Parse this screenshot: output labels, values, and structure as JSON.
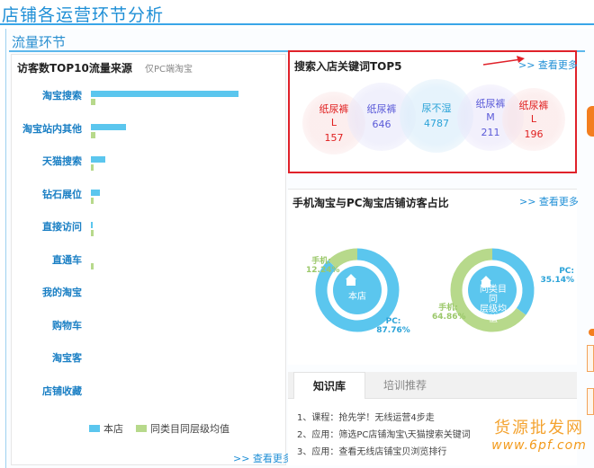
{
  "page": {
    "title": "店铺各运营环节分析",
    "section_title": "流量环节"
  },
  "left_panel": {
    "title": "访客数TOP10流量来源",
    "subtitle": "仅PC端淘宝",
    "categories": [
      "淘宝搜索",
      "淘宝站内其他",
      "天猫搜索",
      "钻石展位",
      "直接访问",
      "直通车",
      "我的淘宝",
      "购物车",
      "淘宝客",
      "店铺收藏"
    ],
    "store_bar_pct": [
      100,
      24,
      10,
      6,
      1,
      0,
      0,
      0,
      0,
      0
    ],
    "peer_bar_pct": [
      3,
      3,
      2,
      1,
      1,
      1,
      0,
      0,
      0,
      0
    ],
    "legend": {
      "store": "本店",
      "peer": "同类目同层级均值"
    },
    "more": ">> 查看更多"
  },
  "keywords_card": {
    "title": "搜索入店关键词TOP5",
    "more": ">> 查看更多",
    "keywords": [
      {
        "line1": "纸尿裤",
        "line2": "L",
        "value": "157",
        "color": "#e02020"
      },
      {
        "line1": "纸尿裤",
        "line2": "",
        "value": "646",
        "color": "#5a5ad8"
      },
      {
        "line1": "尿不湿",
        "line2": "",
        "value": "4787",
        "color": "#2ba3d8"
      },
      {
        "line1": "纸尿裤",
        "line2": "M",
        "value": "211",
        "color": "#5a5ad8"
      },
      {
        "line1": "纸尿裤",
        "line2": "L",
        "value": "196",
        "color": "#e02020"
      }
    ]
  },
  "ratio_card": {
    "title": "手机淘宝与PC淘宝店铺访客占比",
    "more": ">> 查看更多",
    "store": {
      "center": "本店",
      "mobile_label": "手机:",
      "mobile_value": "12.24%",
      "pc_label": "PC:",
      "pc_value": "87.76%",
      "mobile_fraction": 0.1224
    },
    "peer": {
      "center_line1": "同类目同",
      "center_line2": "层级均值",
      "mobile_label": "手机:",
      "mobile_value": "64.86%",
      "pc_label": "PC:",
      "pc_value": "35.14%",
      "mobile_fraction": 0.6486
    },
    "colors": {
      "pc": "#5bc6ee",
      "mobile": "#b7d98b"
    }
  },
  "knowledge": {
    "tabs": [
      "知识库",
      "培训推荐"
    ],
    "items": [
      "1、课程：抢先学！无线运营4步走",
      "2、应用：筛选PC店铺淘宝\\天猫搜索关键词",
      "3、应用：查看无线店铺宝贝浏览排行"
    ]
  },
  "watermark": {
    "line1": "货源批发网",
    "line2": "www.6pf.com"
  }
}
